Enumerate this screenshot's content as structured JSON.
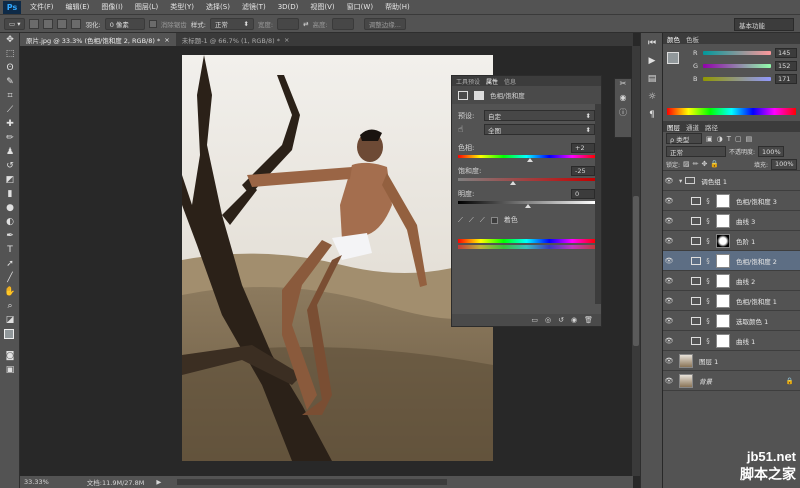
{
  "app": {
    "logo": "Ps"
  },
  "menu": [
    "文件(F)",
    "编辑(E)",
    "图像(I)",
    "图层(L)",
    "类型(Y)",
    "选择(S)",
    "滤镜(T)",
    "3D(D)",
    "视图(V)",
    "窗口(W)",
    "帮助(H)"
  ],
  "options_bar": {
    "feather_label": "羽化:",
    "feather_value": "0 像素",
    "antialias_label": "消除锯齿",
    "style_label": "样式:",
    "style_value": "正常",
    "width_label": "宽度:",
    "height_label": "高度:",
    "refine_label": "调整边缘..."
  },
  "workspace": "基本功能",
  "doc_tabs": [
    {
      "label": "原片.jpg @ 33.3% (色相/饱和度 2, RGB/8) *",
      "close": "×"
    },
    {
      "label": "未标题-1 @ 66.7% (1, RGB/8) *",
      "close": "×"
    }
  ],
  "status": {
    "zoom": "33.33%",
    "doc": "文档:11.9M/27.8M"
  },
  "color_panel": {
    "tabs": [
      "颜色",
      "色板"
    ],
    "R": {
      "label": "R",
      "value": "145"
    },
    "G": {
      "label": "G",
      "value": "152"
    },
    "B": {
      "label": "B",
      "value": "171"
    }
  },
  "layers_panel": {
    "tabs": [
      "图层",
      "通道",
      "路径"
    ],
    "kind_label": "ρ 类型",
    "blend_mode": "正常",
    "opacity_label": "不透明度:",
    "opacity_value": "100%",
    "lock_label": "锁定:",
    "fill_label": "填充:",
    "fill_value": "100%",
    "rows": [
      {
        "name": "调色组 1",
        "type": "group",
        "selected": false
      },
      {
        "name": "色相/饱和度 3",
        "type": "hue",
        "selected": false
      },
      {
        "name": "曲线 3",
        "type": "curve",
        "selected": false
      },
      {
        "name": "色阶 1",
        "type": "levels",
        "selected": false
      },
      {
        "name": "色相/饱和度 2",
        "type": "hue",
        "selected": true
      },
      {
        "name": "曲线 2",
        "type": "curve",
        "selected": false
      },
      {
        "name": "色相/饱和度 1",
        "type": "hue",
        "selected": false
      },
      {
        "name": "选取颜色 1",
        "type": "selective",
        "selected": false
      },
      {
        "name": "曲线 1",
        "type": "curve",
        "selected": false
      },
      {
        "name": "图层 1",
        "type": "pixel",
        "selected": false
      },
      {
        "name": "背景",
        "type": "background",
        "selected": false
      }
    ]
  },
  "properties": {
    "tabs": [
      "工具预设",
      "属性",
      "信息"
    ],
    "title": "色相/饱和度",
    "preset_label": "预设:",
    "preset_value": "自定",
    "channel_value": "全图",
    "hue_label": "色相:",
    "hue_value": "+2",
    "sat_label": "饱和度:",
    "sat_value": "-25",
    "light_label": "明度:",
    "light_value": "0",
    "colorize_label": "着色"
  },
  "watermark": {
    "line1": "jb51.net",
    "line2": "脚本之家"
  }
}
